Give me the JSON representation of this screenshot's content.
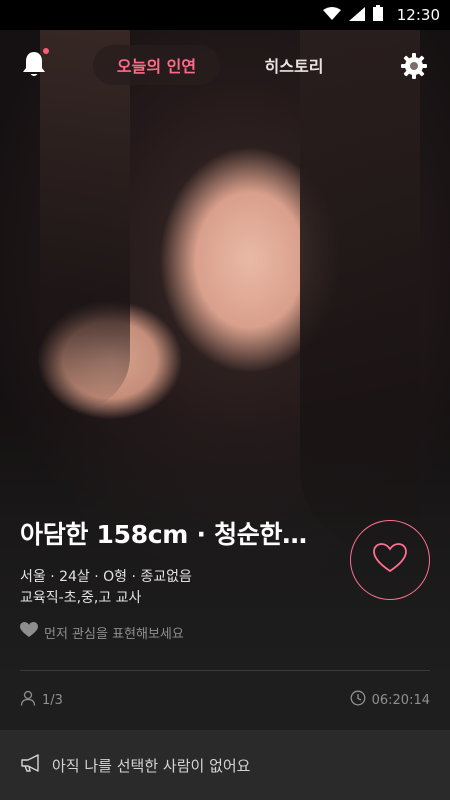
{
  "status_bar": {
    "time": "12:30",
    "icons": [
      "wifi-icon",
      "cellular-signal-icon",
      "battery-icon"
    ]
  },
  "nav": {
    "tabs": [
      {
        "label": "오늘의 인연",
        "active": true
      },
      {
        "label": "히스토리",
        "active": false
      }
    ],
    "left_icon": "bell-icon",
    "right_icon": "gear-icon",
    "has_notification": true
  },
  "profile": {
    "headline": "아담한 158cm · 청순한…",
    "details_line1": "서울 · 24살 · O형  · 종교없음",
    "details_line2": "교육직-초,중,고 교사",
    "interest_hint": "먼저 관심을 표현해보세요"
  },
  "meta": {
    "count": "1/3",
    "timer": "06:20:14"
  },
  "bottom_bar": {
    "message": "아직 나를 선택한 사람이 없어요"
  },
  "colors": {
    "accent": "#ff6a88",
    "background": "#1e1e1e",
    "bottom_bar": "#2a2a2a"
  }
}
